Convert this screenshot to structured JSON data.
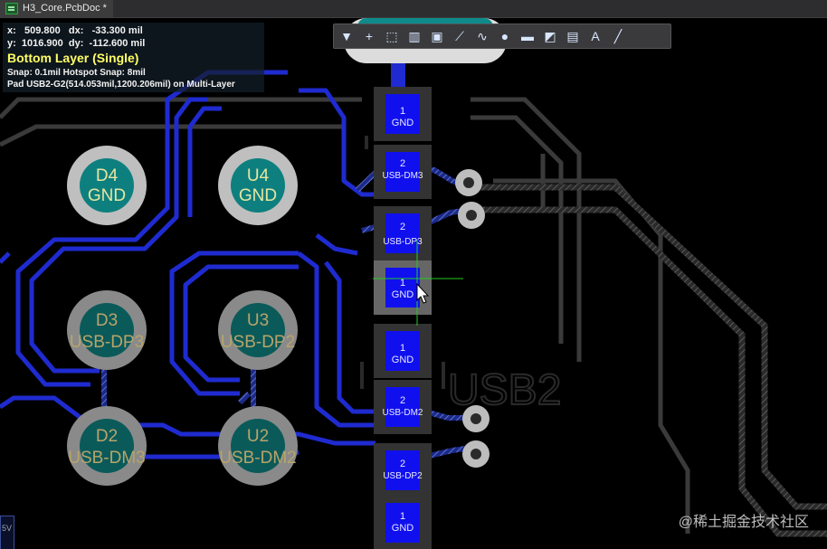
{
  "tab": {
    "title": "H3_Core.PcbDoc *"
  },
  "hud": {
    "x_label": "x:",
    "x_val": "509.800",
    "dx_label": "dx:",
    "dx_val": "-33.300 mil",
    "y_label": "y:",
    "y_val": "1016.900",
    "dy_label": "dy:",
    "dy_val": "-112.600 mil",
    "layer": "Bottom Layer (Single)",
    "snap": "Snap: 0.1mil Hotspot Snap: 8mil",
    "pad_info": "Pad USB2-G2(514.053mil,1200.206mil) on Multi-Layer"
  },
  "toolbar": {
    "items": [
      {
        "name": "filter-icon",
        "glyph": "▼"
      },
      {
        "name": "cross-icon",
        "glyph": "+"
      },
      {
        "name": "select-rect-icon",
        "glyph": "⬚"
      },
      {
        "name": "align-icon",
        "glyph": "▥"
      },
      {
        "name": "chip-icon",
        "glyph": "▣"
      },
      {
        "name": "route-icon",
        "glyph": "⟋"
      },
      {
        "name": "diff-pair-icon",
        "glyph": "∿"
      },
      {
        "name": "via-icon",
        "glyph": "●"
      },
      {
        "name": "fill-icon",
        "glyph": "▬"
      },
      {
        "name": "polygon-icon",
        "glyph": "◩"
      },
      {
        "name": "dimension-icon",
        "glyph": "▤"
      },
      {
        "name": "text-icon",
        "glyph": "A"
      },
      {
        "name": "line-icon",
        "glyph": "╱"
      }
    ]
  },
  "pads_round": [
    {
      "ref": "D4",
      "net": "GND"
    },
    {
      "ref": "U4",
      "net": "GND"
    },
    {
      "ref": "D3",
      "net": "USB-DP3"
    },
    {
      "ref": "U3",
      "net": "USB-DP2"
    },
    {
      "ref": "D2",
      "net": "USB-DM3"
    },
    {
      "ref": "U2",
      "net": "USB-DM2"
    }
  ],
  "pads_smd": [
    {
      "num": "1",
      "net": "GND"
    },
    {
      "num": "2",
      "net": "USB-DM3"
    },
    {
      "num": "2",
      "net": "USB-DP3"
    },
    {
      "num": "1",
      "net": "GND"
    },
    {
      "num": "1",
      "net": "GND"
    },
    {
      "num": "2",
      "net": "USB-DM2"
    },
    {
      "num": "2",
      "net": "USB-DP2"
    },
    {
      "num": "1",
      "net": "GND"
    }
  ],
  "silk": {
    "designator": "USB2"
  },
  "corner": {
    "label": "5V"
  },
  "watermark": "@稀土掘金技术社区"
}
